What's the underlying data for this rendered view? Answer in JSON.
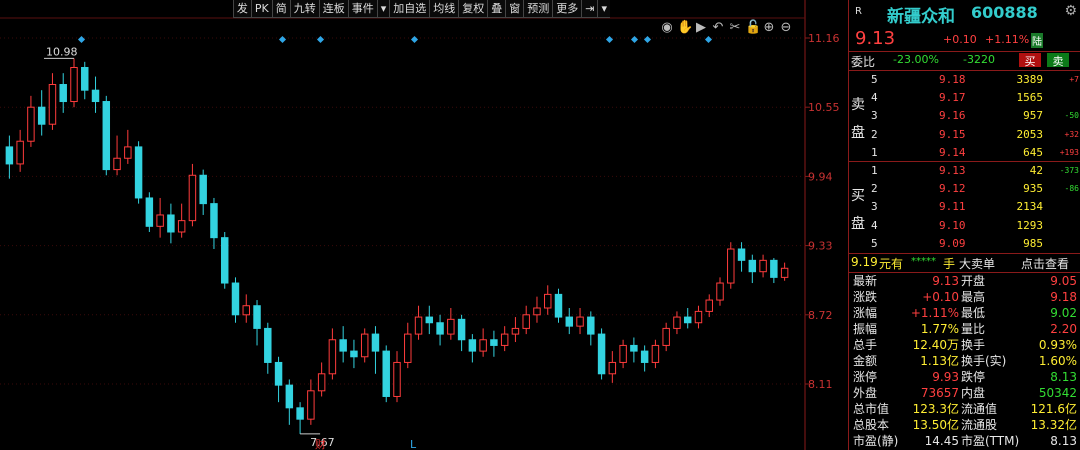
{
  "toolbar": [
    "发",
    "PK",
    "简",
    "九转",
    "连板",
    "事件",
    "▾",
    "加自选",
    "均线",
    "复权",
    "叠",
    "窗",
    "预测",
    "更多",
    "⇥",
    "▾"
  ],
  "zoom_icons": [
    "eye-icon",
    "hand-icon",
    "play-icon",
    "undo-icon",
    "scissors-icon",
    "lock-icon",
    "zoom-in-icon",
    "zoom-out-icon"
  ],
  "chart_data": {
    "type": "candlestick",
    "y_ticks": [
      "11.16",
      "10.55",
      "9.94",
      "9.33",
      "8.72",
      "8.11"
    ],
    "y_tick_values": [
      11.16,
      10.55,
      9.94,
      9.33,
      8.72,
      8.11
    ],
    "ylim": [
      7.55,
      11.25
    ],
    "high_label": "10.98",
    "low_label": "7.67",
    "markers": [
      "财",
      "L"
    ],
    "colors": {
      "up": "#ff3c3c",
      "down": "#33d3e0"
    },
    "candles": [
      [
        10.2,
        10.05,
        10.3,
        9.92
      ],
      [
        10.05,
        10.25,
        10.35,
        9.98
      ],
      [
        10.25,
        10.55,
        10.65,
        10.2
      ],
      [
        10.55,
        10.4,
        10.7,
        10.3
      ],
      [
        10.4,
        10.75,
        10.85,
        10.35
      ],
      [
        10.75,
        10.6,
        10.85,
        10.5
      ],
      [
        10.6,
        10.9,
        10.98,
        10.55
      ],
      [
        10.9,
        10.7,
        10.95,
        10.62
      ],
      [
        10.7,
        10.6,
        10.82,
        10.5
      ],
      [
        10.6,
        10.0,
        10.65,
        9.95
      ],
      [
        10.0,
        10.1,
        10.3,
        9.95
      ],
      [
        10.1,
        10.2,
        10.35,
        10.05
      ],
      [
        10.2,
        9.75,
        10.25,
        9.7
      ],
      [
        9.75,
        9.5,
        9.8,
        9.45
      ],
      [
        9.5,
        9.6,
        9.75,
        9.4
      ],
      [
        9.6,
        9.45,
        9.7,
        9.35
      ],
      [
        9.45,
        9.55,
        9.7,
        9.4
      ],
      [
        9.55,
        9.95,
        10.05,
        9.5
      ],
      [
        9.95,
        9.7,
        10.0,
        9.6
      ],
      [
        9.7,
        9.4,
        9.75,
        9.3
      ],
      [
        9.4,
        9.0,
        9.45,
        8.95
      ],
      [
        9.0,
        8.72,
        9.05,
        8.65
      ],
      [
        8.72,
        8.8,
        8.9,
        8.65
      ],
      [
        8.8,
        8.6,
        8.85,
        8.45
      ],
      [
        8.6,
        8.3,
        8.65,
        8.2
      ],
      [
        8.3,
        8.1,
        8.35,
        7.95
      ],
      [
        8.1,
        7.9,
        8.15,
        7.75
      ],
      [
        7.9,
        7.8,
        7.95,
        7.67
      ],
      [
        7.8,
        8.05,
        8.15,
        7.75
      ],
      [
        8.05,
        8.2,
        8.3,
        8.0
      ],
      [
        8.2,
        8.5,
        8.6,
        8.15
      ],
      [
        8.5,
        8.4,
        8.62,
        8.3
      ],
      [
        8.4,
        8.35,
        8.5,
        8.25
      ],
      [
        8.35,
        8.55,
        8.6,
        8.3
      ],
      [
        8.55,
        8.4,
        8.62,
        8.2
      ],
      [
        8.4,
        8.0,
        8.45,
        7.95
      ],
      [
        8.0,
        8.3,
        8.4,
        7.95
      ],
      [
        8.3,
        8.55,
        8.65,
        8.25
      ],
      [
        8.55,
        8.7,
        8.8,
        8.5
      ],
      [
        8.7,
        8.65,
        8.8,
        8.55
      ],
      [
        8.65,
        8.55,
        8.72,
        8.45
      ],
      [
        8.55,
        8.68,
        8.78,
        8.5
      ],
      [
        8.68,
        8.5,
        8.72,
        8.4
      ],
      [
        8.5,
        8.4,
        8.55,
        8.3
      ],
      [
        8.4,
        8.5,
        8.6,
        8.35
      ],
      [
        8.5,
        8.45,
        8.58,
        8.35
      ],
      [
        8.45,
        8.55,
        8.62,
        8.4
      ],
      [
        8.55,
        8.6,
        8.7,
        8.48
      ],
      [
        8.6,
        8.72,
        8.8,
        8.55
      ],
      [
        8.72,
        8.78,
        8.88,
        8.65
      ],
      [
        8.78,
        8.9,
        8.98,
        8.72
      ],
      [
        8.9,
        8.7,
        8.95,
        8.65
      ],
      [
        8.7,
        8.62,
        8.78,
        8.55
      ],
      [
        8.62,
        8.7,
        8.78,
        8.55
      ],
      [
        8.7,
        8.55,
        8.75,
        8.45
      ],
      [
        8.55,
        8.2,
        8.6,
        8.15
      ],
      [
        8.2,
        8.3,
        8.4,
        8.12
      ],
      [
        8.3,
        8.45,
        8.5,
        8.25
      ],
      [
        8.45,
        8.4,
        8.52,
        8.3
      ],
      [
        8.4,
        8.3,
        8.45,
        8.22
      ],
      [
        8.3,
        8.45,
        8.5,
        8.25
      ],
      [
        8.45,
        8.6,
        8.65,
        8.4
      ],
      [
        8.6,
        8.7,
        8.75,
        8.55
      ],
      [
        8.7,
        8.65,
        8.78,
        8.6
      ],
      [
        8.65,
        8.75,
        8.8,
        8.6
      ],
      [
        8.75,
        8.85,
        8.9,
        8.7
      ],
      [
        8.85,
        9.0,
        9.05,
        8.8
      ],
      [
        9.0,
        9.3,
        9.36,
        8.95
      ],
      [
        9.3,
        9.2,
        9.36,
        9.1
      ],
      [
        9.2,
        9.1,
        9.25,
        9.0
      ],
      [
        9.1,
        9.2,
        9.25,
        9.05
      ],
      [
        9.2,
        9.05,
        9.22,
        9.0
      ],
      [
        9.05,
        9.13,
        9.18,
        9.02
      ]
    ]
  },
  "panel": {
    "r_badge": "R",
    "stock_name": "新疆众和",
    "stock_code": "600888",
    "price": "9.13",
    "change": "+0.10",
    "change_pct": "+1.11%",
    "tag": "陆",
    "wb_label": "委比",
    "wb_pct": "-23.00%",
    "wb_diff": "-3220",
    "buy_btn": "买",
    "sell_btn": "卖",
    "sell_side_label": [
      "卖",
      "盘"
    ],
    "buy_side_label": [
      "买",
      "盘"
    ],
    "sell_levels": [
      {
        "lv": "5",
        "price": "9.18",
        "vol": "3389",
        "chg": "+7",
        "chg_color": "red"
      },
      {
        "lv": "4",
        "price": "9.17",
        "vol": "1565",
        "chg": "",
        "chg_color": "red"
      },
      {
        "lv": "3",
        "price": "9.16",
        "vol": "957",
        "chg": "-50",
        "chg_color": "green"
      },
      {
        "lv": "2",
        "price": "9.15",
        "vol": "2053",
        "chg": "+32",
        "chg_color": "red"
      },
      {
        "lv": "1",
        "price": "9.14",
        "vol": "645",
        "chg": "+193",
        "chg_color": "red"
      }
    ],
    "buy_levels": [
      {
        "lv": "1",
        "price": "9.13",
        "vol": "42",
        "chg": "-373",
        "chg_color": "green"
      },
      {
        "lv": "2",
        "price": "9.12",
        "vol": "935",
        "chg": "-86",
        "chg_color": "green"
      },
      {
        "lv": "3",
        "price": "9.11",
        "vol": "2134",
        "chg": "",
        "chg_color": "red"
      },
      {
        "lv": "4",
        "price": "9.10",
        "vol": "1293",
        "chg": "",
        "chg_color": "red"
      },
      {
        "lv": "5",
        "price": "9.09",
        "vol": "985",
        "chg": "",
        "chg_color": "red"
      }
    ],
    "big_order": {
      "price": "9.19",
      "unit": "元有",
      "stars": "*****",
      "hand": "手",
      "label": "大卖单",
      "action": "点击查看"
    },
    "stats": [
      [
        "最新",
        "9.13",
        "red",
        "开盘",
        "9.05",
        "red"
      ],
      [
        "涨跌",
        "+0.10",
        "red",
        "最高",
        "9.18",
        "red"
      ],
      [
        "涨幅",
        "+1.11%",
        "red",
        "最低",
        "9.02",
        "green"
      ],
      [
        "振幅",
        "1.77%",
        "yellow",
        "量比",
        "2.20",
        "red"
      ],
      [
        "总手",
        "12.40万",
        "yellow",
        "换手",
        "0.93%",
        "yellow"
      ],
      [
        "金额",
        "1.13亿",
        "yellow",
        "换手(实)",
        "1.60%",
        "yellow"
      ],
      [
        "涨停",
        "9.93",
        "red",
        "跌停",
        "8.13",
        "green"
      ],
      [
        "外盘",
        "73657",
        "red",
        "内盘",
        "50342",
        "green"
      ],
      [
        "总市值",
        "123.3亿",
        "yellow",
        "流通值",
        "121.6亿",
        "yellow"
      ],
      [
        "总股本",
        "13.50亿",
        "yellow",
        "流通股",
        "13.32亿",
        "yellow"
      ],
      [
        "市盈(静)",
        "14.45",
        "white",
        "市盈(TTM)",
        "8.13",
        "white"
      ]
    ]
  }
}
